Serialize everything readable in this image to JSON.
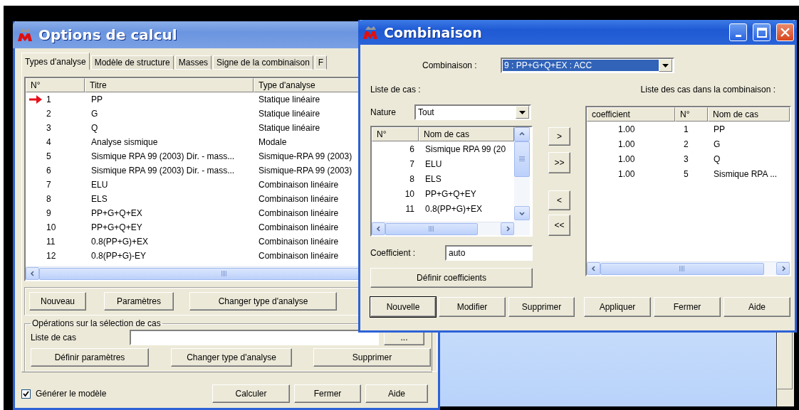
{
  "options_window": {
    "title": "Options de calcul",
    "tabs": [
      {
        "label": "Types d'analyse",
        "selected": true
      },
      {
        "label": "Modèle de structure",
        "selected": false
      },
      {
        "label": "Masses",
        "selected": false
      },
      {
        "label": "Signe de la combinaison",
        "selected": false
      },
      {
        "label": "F",
        "selected": false
      }
    ],
    "case_table": {
      "columns": [
        "N°",
        "Titre",
        "Type d'analyse"
      ],
      "rows": [
        {
          "number": "1",
          "title": "PP",
          "analysis_type": "Statique linéaire",
          "current": true
        },
        {
          "number": "2",
          "title": "G",
          "analysis_type": "Statique linéaire",
          "current": false
        },
        {
          "number": "3",
          "title": "Q",
          "analysis_type": "Statique linéaire",
          "current": false
        },
        {
          "number": "4",
          "title": "Analyse sismique",
          "analysis_type": "Modale",
          "current": false
        },
        {
          "number": "5",
          "title": "Sismique RPA 99 (2003) Dir. - mass...",
          "analysis_type": "Sismique-RPA 99 (2003)",
          "current": false
        },
        {
          "number": "6",
          "title": "Sismique RPA 99 (2003) Dir. - mass...",
          "analysis_type": "Sismique-RPA 99 (2003)",
          "current": false
        },
        {
          "number": "7",
          "title": "ELU",
          "analysis_type": "Combinaison linéaire",
          "current": false
        },
        {
          "number": "8",
          "title": "ELS",
          "analysis_type": "Combinaison linéaire",
          "current": false
        },
        {
          "number": "9",
          "title": "PP+G+Q+EX",
          "analysis_type": "Combinaison linéaire",
          "current": false
        },
        {
          "number": "10",
          "title": "PP+G+Q+EY",
          "analysis_type": "Combinaison linéaire",
          "current": false
        },
        {
          "number": "11",
          "title": "0.8(PP+G)+EX",
          "analysis_type": "Combinaison linéaire",
          "current": false
        },
        {
          "number": "12",
          "title": "0.8(PP+G)-EY",
          "analysis_type": "Combinaison linéaire",
          "current": false
        }
      ]
    },
    "buttons": [
      "Nouveau",
      "Paramètres",
      "Changer type d'analyse"
    ],
    "selection_group": {
      "title": "Opérations sur la sélection de cas",
      "case_list_label": "Liste de cas",
      "browse_button": "...",
      "buttons": [
        "Définir paramètres",
        "Changer type d'analyse",
        "Supprimer"
      ]
    },
    "generate_model": {
      "label": "Générer le modèle",
      "checked": true
    },
    "footer_buttons": [
      "Calculer",
      "Fermer",
      "Aide"
    ]
  },
  "combination_dialog": {
    "title": "Combinaison",
    "combination_label": "Combinaison :",
    "combination_value": "9 : PP+G+Q+EX : ACC",
    "case_list_label": "Liste de cas :",
    "nature_label": "Nature",
    "nature_value": "Tout",
    "case_list": {
      "columns": [
        "N°",
        "Nom de cas"
      ],
      "rows": [
        {
          "number": "6",
          "name": "Sismique RPA 99 (20"
        },
        {
          "number": "7",
          "name": "ELU"
        },
        {
          "number": "8",
          "name": "ELS"
        },
        {
          "number": "10",
          "name": "PP+G+Q+EY"
        },
        {
          "number": "11",
          "name": "0.8(PP+G)+EX"
        }
      ]
    },
    "coefficient_label": "Coefficient :",
    "coefficient_value": "auto",
    "define_button": "Définir coefficients",
    "move_buttons": [
      ">",
      ">>",
      "<",
      "<<"
    ],
    "combination_list_label": "Liste des cas dans la combinaison :",
    "combination_list": {
      "columns": [
        "coefficient",
        "N°",
        "Nom de cas"
      ],
      "rows": [
        {
          "coefficient": "1.00",
          "number": "1",
          "name": "PP"
        },
        {
          "coefficient": "1.00",
          "number": "2",
          "name": "G"
        },
        {
          "coefficient": "1.00",
          "number": "3",
          "name": "Q"
        },
        {
          "coefficient": "1.00",
          "number": "5",
          "name": "Sismique RPA ..."
        }
      ]
    },
    "buttons": [
      {
        "label": "Nouvelle",
        "default": true
      },
      {
        "label": "Modifier",
        "default": false
      },
      {
        "label": "Supprimer",
        "default": false
      },
      {
        "label": "Appliquer",
        "default": false
      },
      {
        "label": "Fermer",
        "default": false
      },
      {
        "label": "Aide",
        "default": false
      }
    ]
  }
}
